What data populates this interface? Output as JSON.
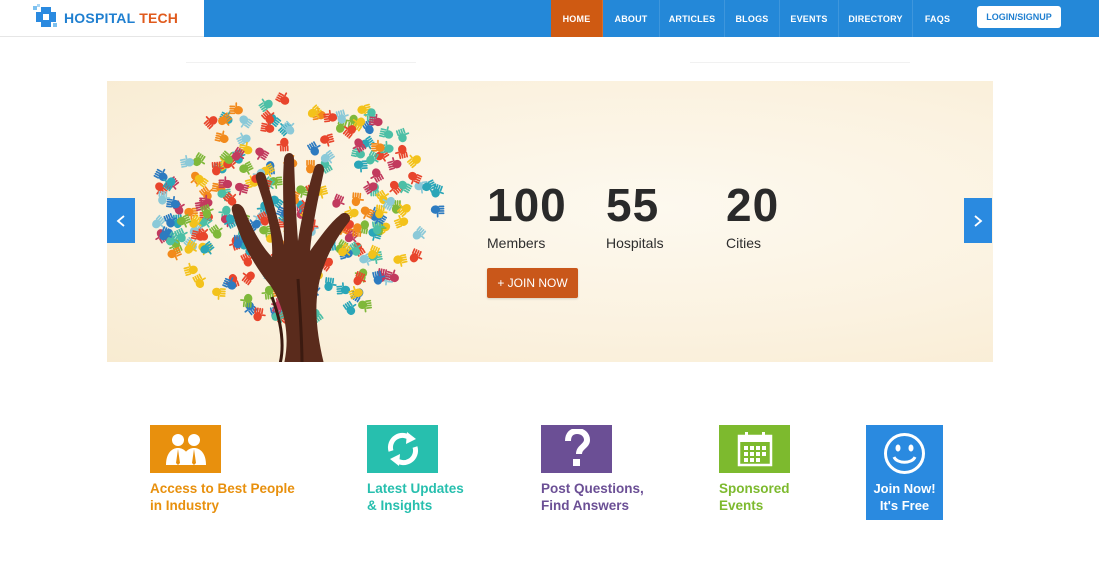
{
  "brand": {
    "name_part1": "HOSPITAL",
    "name_part2": "TECH"
  },
  "nav": {
    "items": [
      {
        "label": "HOME",
        "active": true
      },
      {
        "label": "ABOUT"
      },
      {
        "label": "ARTICLES"
      },
      {
        "label": "BLOGS"
      },
      {
        "label": "EVENTS"
      },
      {
        "label": "DIRECTORY"
      },
      {
        "label": "FAQS"
      }
    ],
    "login_label": "LOGIN/SIGNUP"
  },
  "hero": {
    "stats": [
      {
        "value": "100",
        "label": "Members"
      },
      {
        "value": "55",
        "label": "Hospitals"
      },
      {
        "value": "20",
        "label": "Cities"
      }
    ],
    "join_button": "+ JOIN NOW"
  },
  "features": [
    {
      "line1": "Access to Best People",
      "line2": "in Industry",
      "color": "#e8900d",
      "icon": "people-icon"
    },
    {
      "line1": "Latest Updates",
      "line2": "& Insights",
      "color": "#27bfae",
      "icon": "refresh-icon"
    },
    {
      "line1": "Post Questions,",
      "line2": "Find Answers",
      "color": "#6b4f95",
      "icon": "question-icon"
    },
    {
      "line1": "Sponsored",
      "line2": "Events",
      "color": "#7dba2e",
      "icon": "calendar-icon"
    }
  ],
  "join_card": {
    "line1": "Join Now!",
    "line2": "It's Free",
    "color": "#2a8ae0",
    "icon": "smiley-icon"
  },
  "colors": {
    "header": "#2488d8",
    "active_nav": "#cf5a12",
    "join_button": "#c9571a"
  }
}
